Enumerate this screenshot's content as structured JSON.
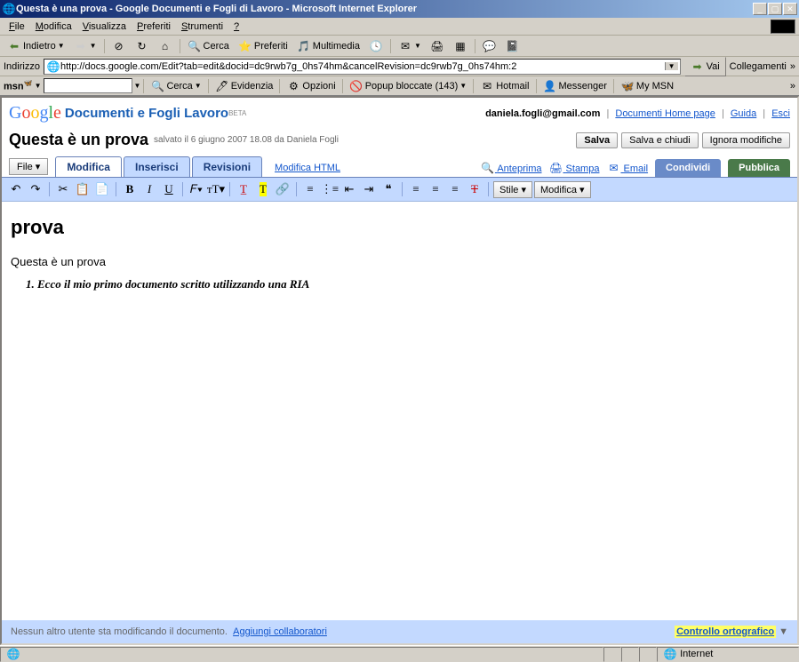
{
  "window": {
    "title": "Questa è una prova - Google Documenti e Fogli di Lavoro - Microsoft Internet Explorer"
  },
  "menubar": {
    "items": [
      "File",
      "Modifica",
      "Visualizza",
      "Preferiti",
      "Strumenti",
      "?"
    ]
  },
  "ie_toolbar": {
    "back": "Indietro",
    "search": "Cerca",
    "fav": "Preferiti",
    "media": "Multimedia"
  },
  "address": {
    "label": "Indirizzo",
    "url": "http://docs.google.com/Edit?tab=edit&docid=dc9rwb7g_0hs74hm&cancelRevision=dc9rwb7g_0hs74hm:2",
    "go": "Vai",
    "links": "Collegamenti"
  },
  "msnbar": {
    "logo": "msn",
    "search_btn": "Cerca",
    "highlight": "Evidenzia",
    "options": "Opzioni",
    "popup": "Popup bloccate (143)",
    "hotmail": "Hotmail",
    "messenger": "Messenger",
    "mymsn": "My MSN"
  },
  "google": {
    "product": "Documenti e Fogli Lavoro",
    "beta": "BETA",
    "email": "daniela.fogli@gmail.com",
    "docshome": "Documenti Home page",
    "help": "Guida",
    "logout": "Esci"
  },
  "document": {
    "title": "Questa è un prova",
    "saved": "salvato il 6 giugno 2007 18.08 da Daniela Fogli",
    "buttons": {
      "save": "Salva",
      "saveclose": "Salva e chiudi",
      "discard": "Ignora modifiche"
    }
  },
  "tabs": {
    "file": "File",
    "edit": "Modifica",
    "insert": "Inserisci",
    "revisions": "Revisioni",
    "edithtml": "Modifica HTML",
    "preview": "Anteprima",
    "print": "Stampa",
    "email": "Email",
    "share": "Condividi",
    "publish": "Pubblica"
  },
  "fmtbar": {
    "style": "Stile",
    "modify": "Modifica"
  },
  "docbody": {
    "h1": "prova",
    "p1": "Questa è un prova",
    "li1": "Ecco il mio primo documento scritto utilizzando una RIA"
  },
  "collab": {
    "noone": "Nessun altro utente sta modificando il documento.",
    "add": "Aggiungi collaboratori",
    "spell": "Controllo ortografico"
  },
  "status": {
    "zone": "Internet"
  }
}
